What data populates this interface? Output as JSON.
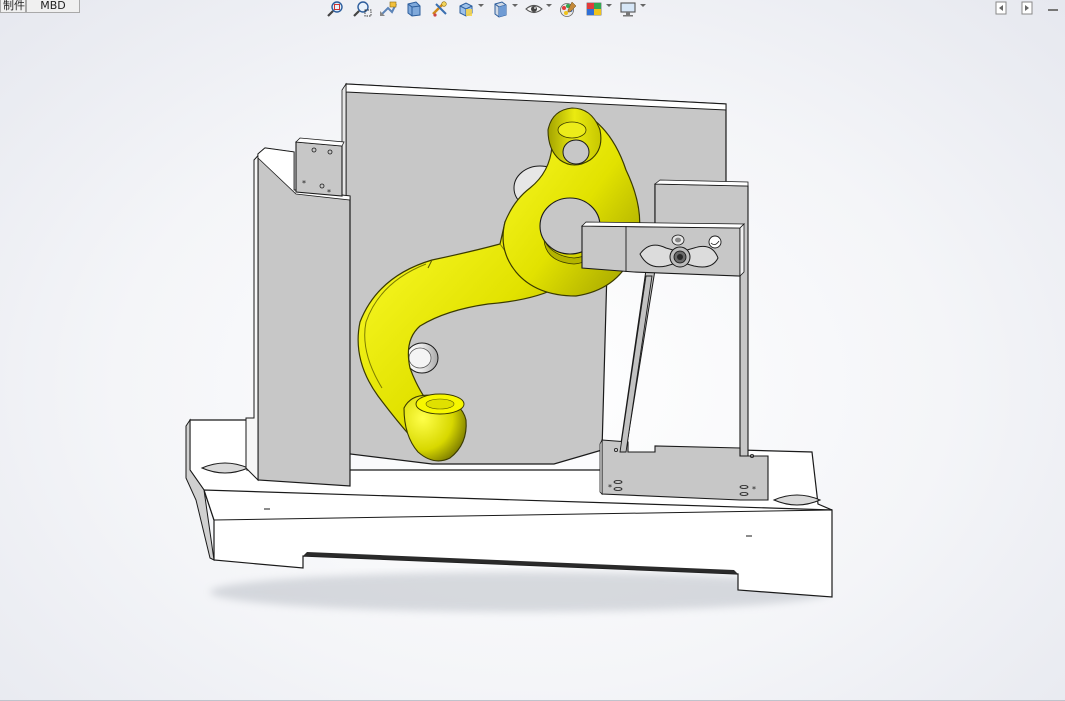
{
  "tabs": {
    "first_label": "制件",
    "mbd_label": "MBD"
  },
  "toolbar": {
    "buttons": [
      {
        "name": "zoom-to-fit-icon"
      },
      {
        "name": "zoom-to-area-icon"
      },
      {
        "name": "previous-view-icon"
      },
      {
        "name": "section-view-icon"
      },
      {
        "name": "dynamic-annotation-icon"
      },
      {
        "name": "view-orientation-icon",
        "dropdown": true
      },
      {
        "name": "display-style-icon",
        "dropdown": true
      },
      {
        "name": "hide-show-items-icon",
        "dropdown": true
      },
      {
        "name": "edit-appearance-icon"
      },
      {
        "name": "apply-scene-icon",
        "dropdown": true
      },
      {
        "name": "view-settings-icon",
        "dropdown": true
      }
    ]
  },
  "colors": {
    "part_yellow": "#e4e400",
    "part_yellow_dark": "#8a8a00",
    "fixture_face": "#c8c8c8",
    "fixture_light": "#ffffff",
    "edge": "#1a1a1a"
  }
}
